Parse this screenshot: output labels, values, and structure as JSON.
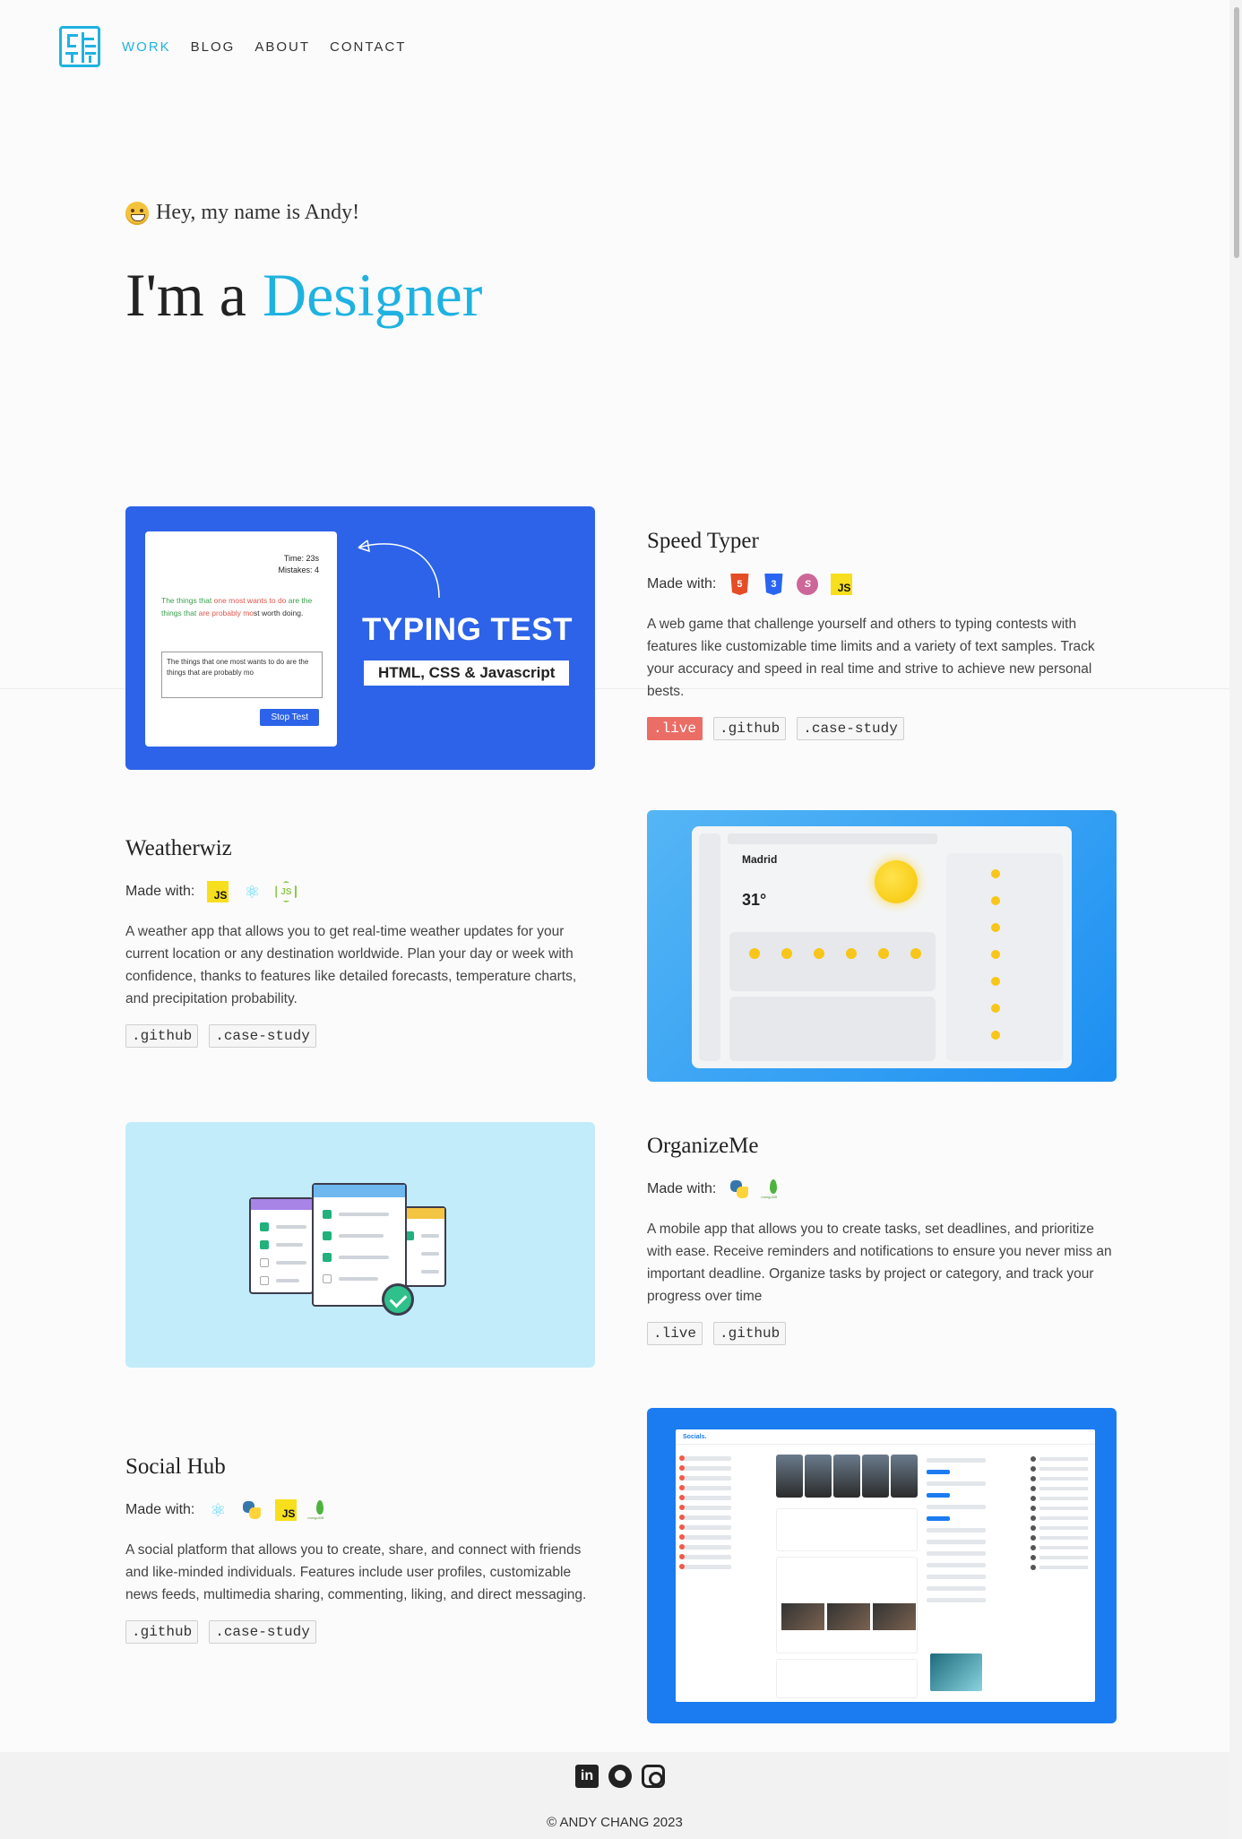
{
  "nav": {
    "logo_name": "logo-icon",
    "items": [
      "WORK",
      "BLOG",
      "ABOUT",
      "CONTACT"
    ]
  },
  "hero": {
    "greeting": "Hey, my name is Andy!",
    "prefix": "I'm a",
    "role": "Designer"
  },
  "made_label": "Made with:",
  "projects": [
    {
      "title": "Speed Typer",
      "tech": [
        "html5-icon",
        "css3-icon",
        "sass-icon",
        "javascript-icon"
      ],
      "description": "A web game that challenge yourself and others to typing contests with features like customizable time limits and a variety of text samples. Track your accuracy and speed in real time and strive to achieve new personal bests.",
      "links": [
        ".live",
        ".github",
        ".case-study"
      ],
      "thumb": {
        "time": "Time: 23s",
        "mistakes": "Mistakes: 4",
        "text_green": "The things that",
        "text_red": "one most wants to do",
        "text_green2": "are the things that",
        "text_red2": "are probably mo",
        "text_rest": "st worth doing.",
        "typed": "The things that one most wants to do are the things that are probably mo",
        "stop": "Stop Test",
        "title": "TYPING TEST",
        "subtitle": "HTML, CSS & Javascript"
      }
    },
    {
      "title": "Weatherwiz",
      "tech": [
        "javascript-icon",
        "react-icon",
        "nodejs-icon"
      ],
      "description": "A weather app that allows you to get real-time weather updates for your current location or any destination worldwide. Plan your day or week with confidence, thanks to features like detailed forecasts, temperature charts, and precipitation probability.",
      "links": [
        ".github",
        ".case-study"
      ],
      "thumb": {
        "city": "Madrid",
        "temp": "31°"
      }
    },
    {
      "title": "OrganizeMe",
      "tech": [
        "python-icon",
        "mongodb-icon"
      ],
      "description": "A mobile app that allows you to create tasks, set deadlines, and prioritize with ease. Receive reminders and notifications to ensure you never miss an important deadline. Organize tasks by project or category, and track your progress over time",
      "links": [
        ".live",
        ".github"
      ]
    },
    {
      "title": "Social Hub",
      "tech": [
        "react-icon",
        "python-icon",
        "javascript-icon",
        "mongodb-icon"
      ],
      "description": "A social platform that allows you to create, share, and connect with friends and like-minded individuals. Features include user profiles, customizable news feeds, multimedia sharing, commenting, liking, and direct messaging.",
      "links": [
        ".github",
        ".case-study"
      ],
      "thumb": {
        "brand": "Socials."
      }
    }
  ],
  "colors": {
    "accent": "#1fb2e0",
    "live_button": "#ea6d66",
    "typing_bg": "#2d63e8",
    "social_bg": "#1a7cf0",
    "organize_bg": "#c3ecfb"
  },
  "footer": {
    "socials": [
      "linkedin-icon",
      "github-icon",
      "instagram-icon"
    ],
    "linkedin_glyph": "in",
    "copyright": "© ANDY CHANG 2023"
  }
}
